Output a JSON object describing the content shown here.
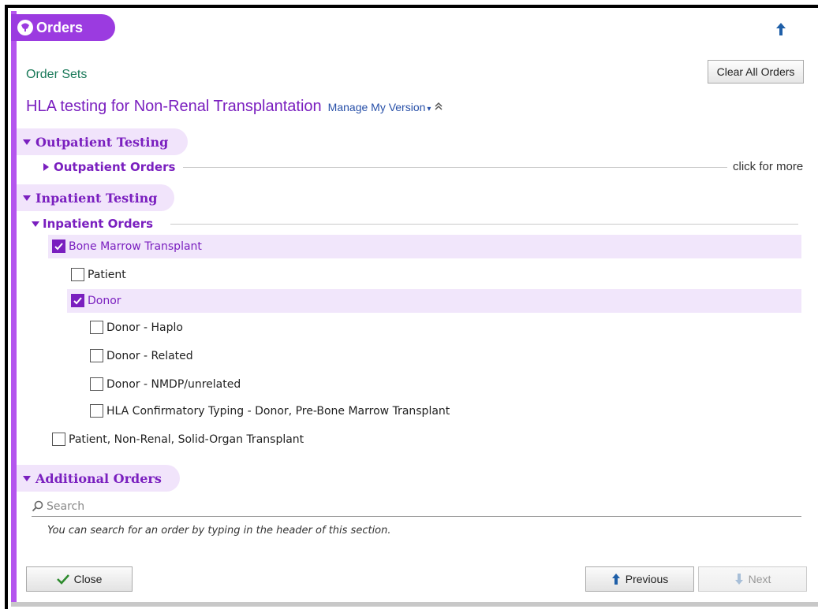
{
  "header": {
    "title": "Orders"
  },
  "order_sets_label": "Order Sets",
  "clear_all_label": "Clear All Orders",
  "order_set": {
    "title": "HLA testing for Non-Renal Transplantation",
    "manage_label": "Manage My Version",
    "manage_caret": "▾",
    "collapse_glyph": "≈"
  },
  "sections": {
    "outpatient": {
      "label": "Outpatient Testing",
      "group_label": "Outpatient Orders",
      "more_label": "click for more"
    },
    "inpatient": {
      "label": "Inpatient Testing",
      "group_label": "Inpatient Orders",
      "items": {
        "bmt": {
          "label": "Bone Marrow Transplant",
          "checked": true
        },
        "patient": {
          "label": "Patient",
          "checked": false
        },
        "donor": {
          "label": "Donor",
          "checked": true
        },
        "haplo": {
          "label": "Donor - Haplo",
          "checked": false
        },
        "related": {
          "label": "Donor - Related",
          "checked": false
        },
        "nmdp": {
          "label": "Donor - NMDP/unrelated",
          "checked": false
        },
        "confirm": {
          "label": "HLA Confirmatory Typing - Donor, Pre-Bone Marrow Transplant",
          "checked": false
        },
        "solid": {
          "label": "Patient, Non-Renal, Solid-Organ Transplant",
          "checked": false
        }
      }
    },
    "additional": {
      "label": "Additional Orders",
      "search_placeholder": "Search",
      "hint": "You can search for an order by typing in the header of this section."
    }
  },
  "footer": {
    "close_label": "Close",
    "previous_label": "Previous",
    "next_label": "Next"
  },
  "colors": {
    "accent": "#9b3be0",
    "accent_text": "#7a1fbf",
    "highlight_row": "#f1e6fb",
    "order_sets_green": "#1b7a5a",
    "link_blue": "#2850a8",
    "arrow_blue": "#1f5fa8",
    "check_green": "#2e8b2e"
  }
}
